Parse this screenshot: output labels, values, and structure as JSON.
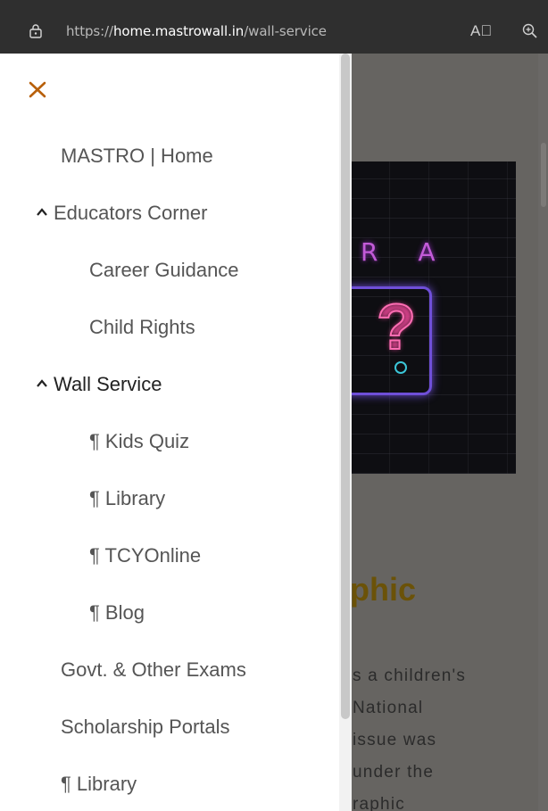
{
  "browser": {
    "url_scheme": "https://",
    "url_host": "home.mastrowall.in",
    "url_path": "/wall-service",
    "read_aloud_label": "A⃝"
  },
  "page": {
    "hero_text": "R A",
    "heading": "phic",
    "paragraph": [
      "s a children's",
      "National",
      "issue was",
      "under the",
      "raphic"
    ]
  },
  "menu": {
    "items": [
      {
        "label": "MASTRO | Home",
        "chevron": false,
        "level": 0
      },
      {
        "label": "Educators Corner",
        "chevron": true,
        "level": 0
      },
      {
        "label": "Career Guidance",
        "chevron": false,
        "level": 1
      },
      {
        "label": "Child Rights",
        "chevron": false,
        "level": 1
      },
      {
        "label": "Wall Service",
        "chevron": true,
        "level": 0
      },
      {
        "label": "¶ Kids Quiz",
        "chevron": false,
        "level": 1
      },
      {
        "label": "¶ Library",
        "chevron": false,
        "level": 1
      },
      {
        "label": "¶ TCYOnline",
        "chevron": false,
        "level": 1
      },
      {
        "label": "¶ Blog",
        "chevron": false,
        "level": 1
      },
      {
        "label": "Govt. & Other Exams",
        "chevron": false,
        "level": 0
      },
      {
        "label": "Scholarship Portals",
        "chevron": false,
        "level": 0
      },
      {
        "label": "¶ Library",
        "chevron": false,
        "level": 0
      }
    ]
  },
  "colors": {
    "close_icon": "#b8600a",
    "heading": "#6b5208"
  }
}
